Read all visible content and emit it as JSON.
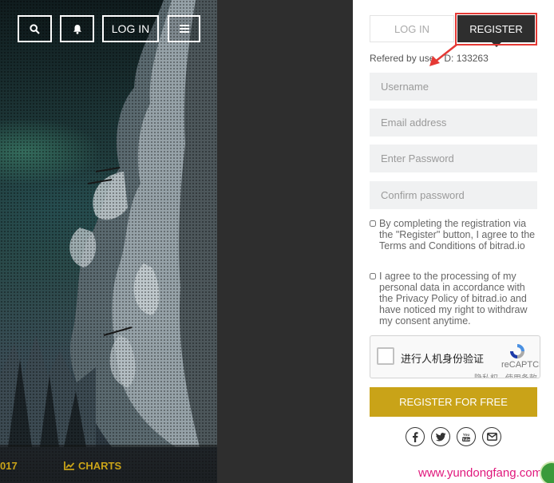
{
  "header": {
    "login_label": "LOG IN",
    "icons": [
      "search-icon",
      "bell-icon",
      "menu-icon"
    ]
  },
  "bottom_bar": {
    "year_text": "017",
    "charts_label": "CHARTS"
  },
  "tabs": {
    "login_label": "LOG IN",
    "register_label": "REGISTER"
  },
  "referral": {
    "prefix": "Refered by use",
    "suffix": "D: 133263"
  },
  "form": {
    "username_placeholder": "Username",
    "email_placeholder": "Email address",
    "password_placeholder": "Enter Password",
    "confirm_placeholder": "Confirm password",
    "terms_text": "By completing the registration via the \"Register\" button, I agree to the Terms and Conditions of bitrad.io",
    "privacy_text": "I agree to the processing of my personal data in accordance with the Privacy Policy of bitrad.io and have noticed my right to withdraw my consent anytime.",
    "submit_label": "REGISTER FOR FREE"
  },
  "captcha": {
    "label": "进行人机身份验证",
    "brand": "reCAPTCHA",
    "terms": "隐私权 - 使用条款"
  },
  "social": [
    "facebook-icon",
    "twitter-icon",
    "youtube-icon",
    "email-icon"
  ],
  "watermark": "www.yundongfang.com",
  "colors": {
    "accent": "#c9a318",
    "dark": "#2e2e2e",
    "annotation": "#e53935",
    "watermark": "#e0187c"
  }
}
